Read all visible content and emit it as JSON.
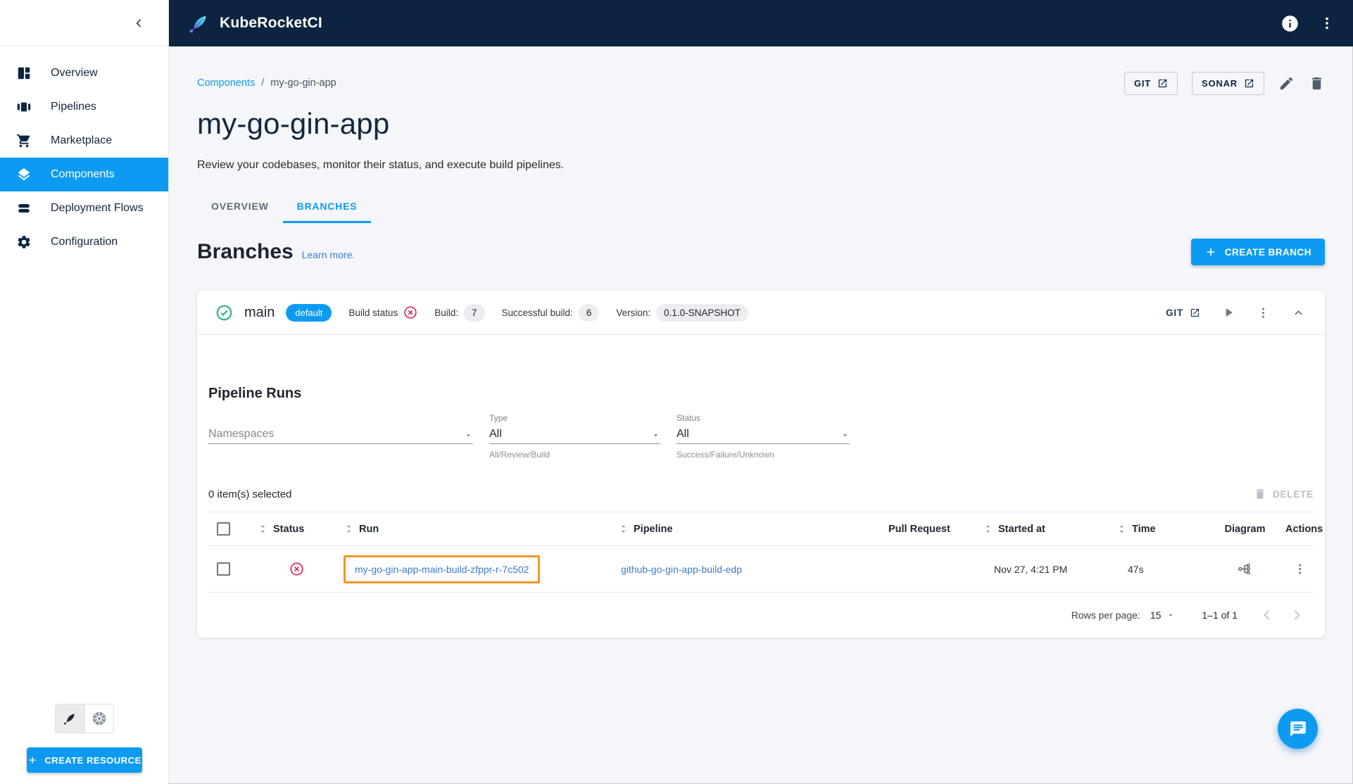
{
  "header": {
    "app_title": "KubeRocketCI"
  },
  "sidebar": {
    "items": [
      {
        "label": "Overview"
      },
      {
        "label": "Pipelines"
      },
      {
        "label": "Marketplace"
      },
      {
        "label": "Components"
      },
      {
        "label": "Deployment Flows"
      },
      {
        "label": "Configuration"
      }
    ],
    "create_resource_label": "CREATE RESOURCE"
  },
  "breadcrumb": {
    "parent": "Components",
    "separator": "/",
    "current": "my-go-gin-app"
  },
  "page": {
    "title": "my-go-gin-app",
    "subtitle": "Review your codebases, monitor their status, and execute build pipelines."
  },
  "toolbar": {
    "git_label": "GIT",
    "sonar_label": "SONAR"
  },
  "tabs": {
    "overview": "OVERVIEW",
    "branches": "BRANCHES"
  },
  "branches_section": {
    "title": "Branches",
    "learn_more_label": "Learn more.",
    "create_branch_label": "CREATE BRANCH"
  },
  "branch": {
    "name": "main",
    "default_chip": "default",
    "build_status_label": "Build status",
    "build_label": "Build:",
    "build_count": "7",
    "successful_build_label": "Successful build:",
    "successful_build_count": "6",
    "version_label": "Version:",
    "version_value": "0.1.0-SNAPSHOT",
    "git_label": "GIT"
  },
  "pipeline_runs": {
    "title": "Pipeline Runs",
    "filters": {
      "namespaces_placeholder": "Namespaces",
      "type_label": "Type",
      "type_value": "All",
      "type_helper": "All/Review/Build",
      "status_label": "Status",
      "status_value": "All",
      "status_helper": "Success/Failure/Unknown"
    },
    "selection_text": "0 item(s) selected",
    "delete_label": "DELETE",
    "table": {
      "columns": [
        "Status",
        "Run",
        "Pipeline",
        "Pull Request",
        "Started at",
        "Time",
        "Diagram",
        "Actions"
      ],
      "rows": [
        {
          "status": "failed",
          "run": "my-go-gin-app-main-build-zfppr-r-7c502",
          "pipeline": "github-go-gin-app-build-edp",
          "pull_request": "",
          "started_at": "Nov 27, 4:21 PM",
          "time": "47s"
        }
      ]
    },
    "pagination": {
      "rows_per_page_label": "Rows per page:",
      "rows_per_page_value": "15",
      "range_text": "1–1 of 1"
    }
  },
  "colors": {
    "accent": "#0d9bf2",
    "header_bg": "#0c2440",
    "success": "#22b573",
    "error": "#e7265d",
    "highlight_box": "#ef9727",
    "link": "#3d7bd0"
  }
}
